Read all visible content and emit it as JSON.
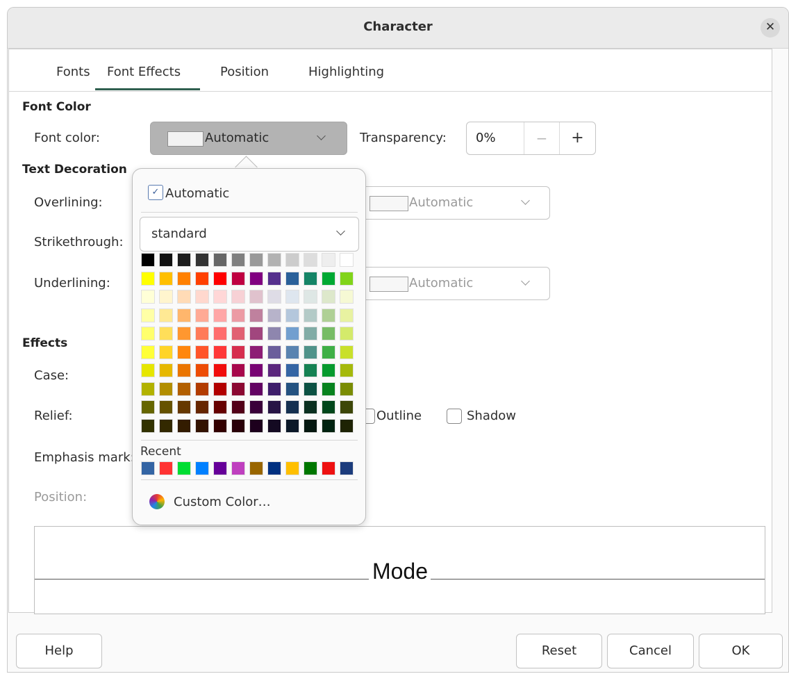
{
  "window": {
    "title": "Character"
  },
  "tabs": [
    "Fonts",
    "Font Effects",
    "Position",
    "Highlighting"
  ],
  "font_color_section": {
    "header": "Font Color",
    "font_color_label": "Font color:",
    "font_color_value": "Automatic",
    "transparency_label": "Transparency:",
    "transparency_value": "0%",
    "minus": "−",
    "plus": "+"
  },
  "text_decoration": {
    "header": "Text Decoration",
    "overlining_label": "Overlining:",
    "overlining_color": "Automatic",
    "strikethrough_label": "Strikethrough:",
    "underlining_label": "Underlining:",
    "underlining_color": "Automatic"
  },
  "effects": {
    "header": "Effects",
    "case_label": "Case:",
    "relief_label": "Relief:",
    "outline_label": "Outline",
    "shadow_label": "Shadow",
    "emphasis_label": "Emphasis mark:",
    "position_label": "Position:"
  },
  "preview": {
    "text": "Mode"
  },
  "buttons": {
    "help": "Help",
    "reset": "Reset",
    "cancel": "Cancel",
    "ok": "OK"
  },
  "color_popup": {
    "automatic_label": "Automatic",
    "palette": "standard",
    "recent_label": "Recent",
    "custom_color_label": "Custom Color…",
    "palette_rows": [
      [
        "#000000",
        "#111111",
        "#1c1c1c",
        "#333333",
        "#666666",
        "#808080",
        "#999999",
        "#b2b2b2",
        "#cccccc",
        "#dddddd",
        "#eeeeee",
        "#ffffff"
      ],
      [
        "#ffff00",
        "#ffbf00",
        "#ff8000",
        "#ff4000",
        "#ff0000",
        "#bf0041",
        "#800080",
        "#55308d",
        "#2a6099",
        "#158466",
        "#00a933",
        "#81d41a"
      ],
      [
        "#ffffd7",
        "#fff5ce",
        "#ffdbb6",
        "#ffd8ce",
        "#ffd7d7",
        "#f7d1d5",
        "#e0c2cd",
        "#dedce6",
        "#dee6ef",
        "#dee7e5",
        "#dde8cb",
        "#f6f9d4"
      ],
      [
        "#ffff a6",
        "#ffe994",
        "#ffb66c",
        "#ffaa95",
        "#ffa6a6",
        "#ec9ba4",
        "#bf819e",
        "#b7b3ca",
        "#b4c7dc",
        "#b3cac7",
        "#afd095",
        "#e8f2a1"
      ],
      [
        "#ffff6d",
        "#ffde59",
        "#ff972f",
        "#ff7b59",
        "#ff6d6d",
        "#e16173",
        "#a1467e",
        "#8e86ae",
        "#729fcf",
        "#81aca6",
        "#77bc65",
        "#d4ea6b"
      ],
      [
        "#ffff38",
        "#ffd428",
        "#ff860d",
        "#ff5429",
        "#ff3838",
        "#d62e4e",
        "#8d1d75",
        "#6b5e9b",
        "#5983b0",
        "#50938a",
        "#3faf46",
        "#c9e02b"
      ],
      [
        "#e6e600",
        "#e6b800",
        "#ea7500",
        "#ed4c05",
        "#f10d0c",
        "#a7074b",
        "#780373",
        "#5b277d",
        "#3465a4",
        "#168253",
        "#069a2e",
        "#a5b90b"
      ],
      [
        "#b2b200",
        "#b28e00",
        "#b25f00",
        "#b23c00",
        "#b20000",
        "#8b0832",
        "#620362",
        "#3e1e6b",
        "#245280",
        "#0d5244",
        "#07821e",
        "#7a8c03"
      ],
      [
        "#666600",
        "#665200",
        "#663800",
        "#662600",
        "#660000",
        "#520018",
        "#3a003a",
        "#271445",
        "#153050",
        "#0a3020",
        "#00461a",
        "#3c4608"
      ],
      [
        "#333300",
        "#332900",
        "#331c00",
        "#331300",
        "#330000",
        "#290009",
        "#1d001d",
        "#140a22",
        "#0b1828",
        "#051810",
        "#002310",
        "#1e2304"
      ]
    ],
    "recent_colors": [
      "#3465a4",
      "#ff3333",
      "#00dd33",
      "#0080ff",
      "#660099",
      "#bf40bf",
      "#996600",
      "#003080",
      "#ffbf00",
      "#007700",
      "#ee1111",
      "#1c3c7c"
    ]
  }
}
